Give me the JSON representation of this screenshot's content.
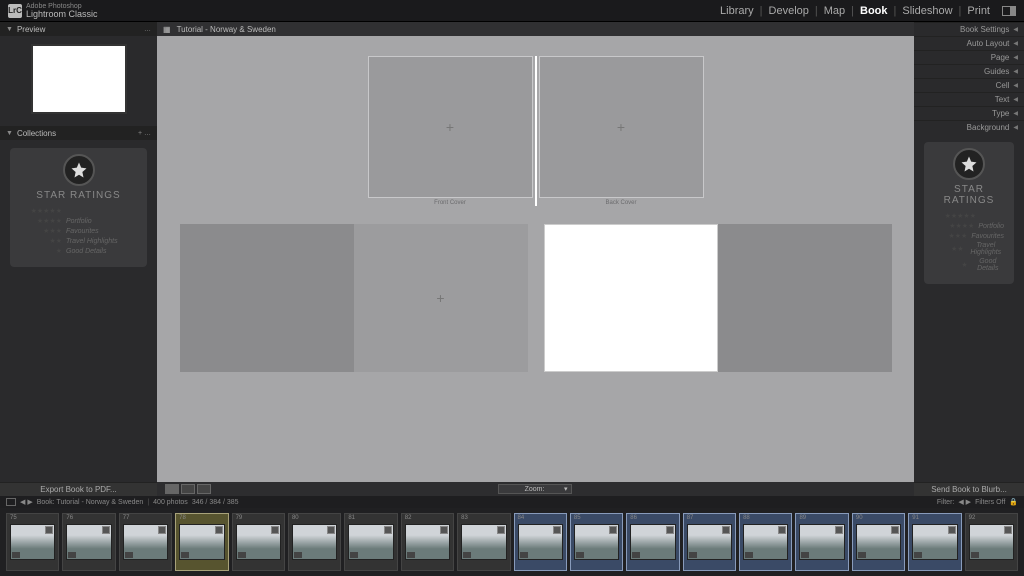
{
  "app": {
    "abbrev": "LrC",
    "name_line1": "Adobe Photoshop",
    "name_line2": "Lightroom Classic"
  },
  "modules": {
    "items": [
      "Library",
      "Develop",
      "Map",
      "Book",
      "Slideshow",
      "Print"
    ],
    "active": "Book"
  },
  "left": {
    "preview_label": "Preview",
    "collections_label": "Collections",
    "ratings_title": "STAR RATINGS",
    "ratings_rows": [
      {
        "stars": "★★★★★",
        "label": ""
      },
      {
        "stars": "★★★★",
        "label": "Portfolio"
      },
      {
        "stars": "★★★",
        "label": "Favourites"
      },
      {
        "stars": "★★",
        "label": "Travel Highlights"
      },
      {
        "stars": "★",
        "label": "Good Details"
      }
    ],
    "export_btn": "Export Book to PDF..."
  },
  "right": {
    "panels": [
      "Book Settings",
      "Auto Layout",
      "Page",
      "Guides",
      "Cell",
      "Text",
      "Type",
      "Background"
    ],
    "ratings_title": "STAR RATINGS",
    "ratings_rows": [
      {
        "stars": "★★★★★",
        "label": ""
      },
      {
        "stars": "★★★★",
        "label": "Portfolio"
      },
      {
        "stars": "★★★",
        "label": "Favourites"
      },
      {
        "stars": "★★",
        "label": "Travel Highlights"
      },
      {
        "stars": "★",
        "label": "Good Details"
      }
    ],
    "send_btn": "Send Book to Blurb..."
  },
  "canvas": {
    "title": "Tutorial - Norway & Sweden",
    "front_label": "Front Cover",
    "back_label": "Back Cover",
    "zoom_label": "Zoom:"
  },
  "filmstrip": {
    "crumb": "Book: Tutorial - Norway & Sweden",
    "count": "400 photos",
    "sel": "346 / 384 / 385",
    "filter_label": "Filter:",
    "filters_off": "Filters Off",
    "start_index": 75,
    "thumb_count": 18,
    "selected": [
      78
    ],
    "selected2": [
      84,
      85,
      86,
      87,
      88,
      89,
      90,
      91
    ]
  }
}
